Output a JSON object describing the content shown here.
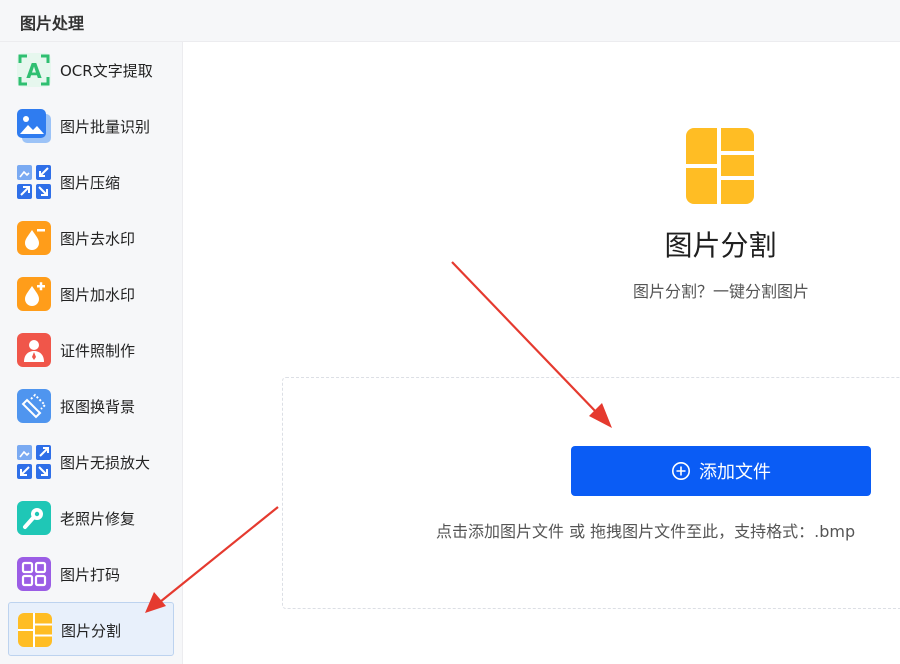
{
  "header": {
    "title": "图片处理"
  },
  "sidebar": {
    "items": [
      {
        "label": "OCR文字提取"
      },
      {
        "label": "图片批量识别"
      },
      {
        "label": "图片压缩"
      },
      {
        "label": "图片去水印"
      },
      {
        "label": "图片加水印"
      },
      {
        "label": "证件照制作"
      },
      {
        "label": "抠图换背景"
      },
      {
        "label": "图片无损放大"
      },
      {
        "label": "老照片修复"
      },
      {
        "label": "图片打码"
      },
      {
        "label": "图片分割",
        "active": true
      }
    ]
  },
  "main": {
    "title": "图片分割",
    "subtitle": "图片分割？一键分割图片",
    "add_button_label": "添加文件",
    "hint": "点击添加图片文件 或 拖拽图片文件至此，支持格式：.bmp"
  },
  "colors": {
    "accent": "#0a5cf5",
    "split_icon": "#ffbd24",
    "annotation_arrow": "#e53a2f"
  }
}
